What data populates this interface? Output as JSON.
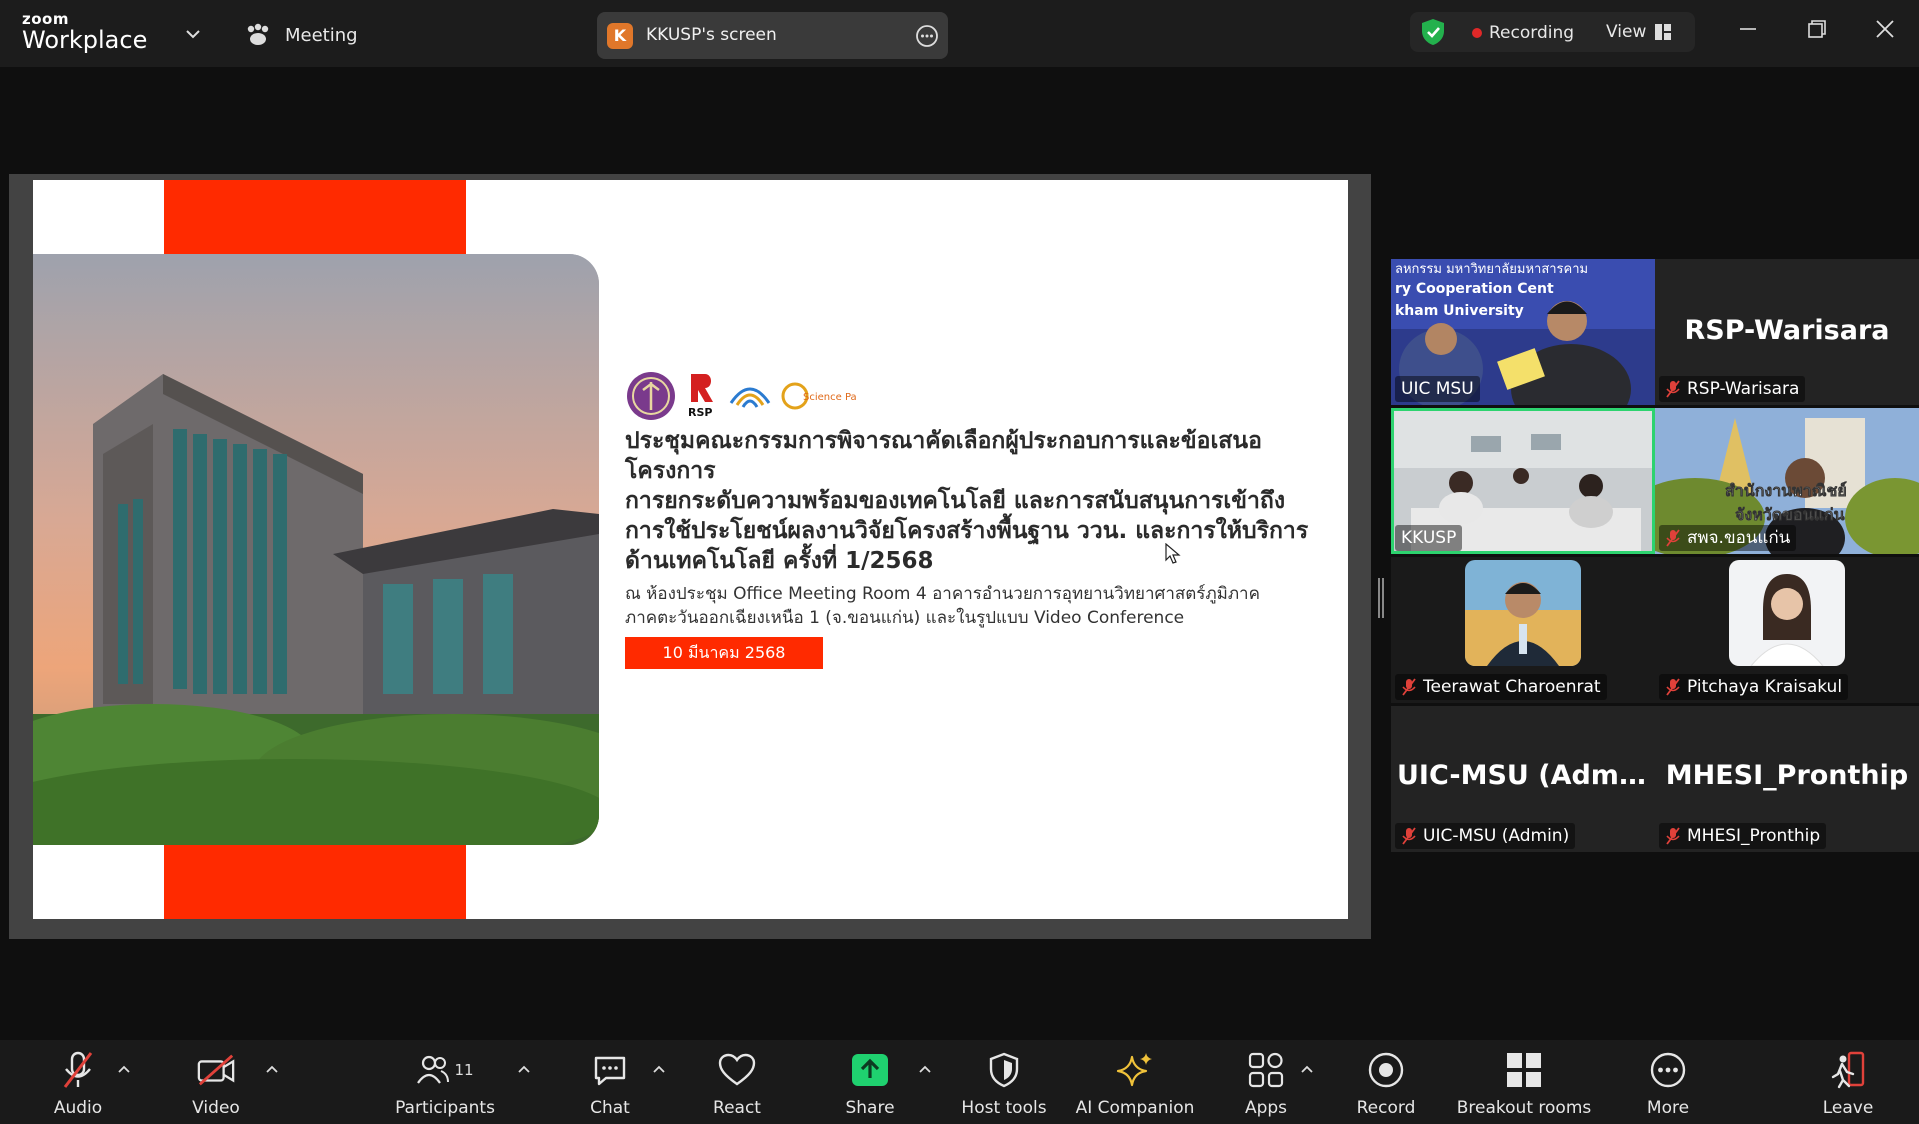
{
  "app": {
    "brand_small": "zoom",
    "brand_big": "Workplace"
  },
  "titlebar": {
    "meeting_label": "Meeting",
    "screen_share_label": "KKUSP's screen",
    "screen_share_initial": "K",
    "recording_label": "Recording",
    "view_label": "View"
  },
  "slide": {
    "heading_lines": [
      "ประชุมคณะกรรมการพิจารณาคัดเลือกผู้ประกอบการและข้อเสนอโครงการ",
      "การยกระดับความพร้อมของเทคโนโลยี และการสนับสนุนการเข้าถึง",
      "การใช้ประโยชน์ผลงานวิจัยโครงสร้างพื้นฐาน ววน. และการให้บริการ",
      "ด้านเทคโนโลยี ครั้งที่ 1/2568"
    ],
    "venue_lines": [
      "ณ ห้องประชุม Office Meeting Room 4 อาคารอำนวยการอุทยานวิทยาศาสตร์ภูมิภาค",
      "ภาคตะวันออกเฉียงเหนือ 1 (จ.ขอนแก่น) และในรูปแบบ Video Conference"
    ],
    "date": "10 มีนาคม 2568",
    "logo_texts": {
      "rsp": "RSP",
      "science_park": "Science Park"
    }
  },
  "participants": [
    {
      "name": "UIC MSU",
      "big_name": "",
      "muted": false,
      "kind": "video-room"
    },
    {
      "name": "RSP-Warisara",
      "big_name": "RSP-Warisara",
      "muted": true,
      "kind": "name-only"
    },
    {
      "name": "KKUSP",
      "big_name": "",
      "muted": false,
      "kind": "video-meeting",
      "active": true
    },
    {
      "name": "สพจ.ขอนแก่น",
      "big_name": "",
      "muted": true,
      "kind": "video-person"
    },
    {
      "name": "Teerawat Charoenrat",
      "big_name": "",
      "muted": true,
      "kind": "avatar"
    },
    {
      "name": "Pitchaya Kraisakul",
      "big_name": "",
      "muted": true,
      "kind": "avatar"
    },
    {
      "name": "UIC-MSU (Admin)",
      "big_name": "UIC-MSU  (Admi...",
      "muted": true,
      "kind": "name-only"
    },
    {
      "name": "MHESI_Pronthip",
      "big_name": "MHESI_Pronthip",
      "muted": true,
      "kind": "name-only"
    }
  ],
  "tile_overlay_texts": {
    "uic_banner_1": "ลหกรรม มหาวิทยาลัยมหาสารคาม",
    "uic_banner_2": "ry Cooperation Cent",
    "uic_banner_3": "kham University",
    "spj_overlay_1": "สำนักงานพาณิชย์",
    "spj_overlay_2": "จังหวัดขอนแก่น"
  },
  "toolbar": {
    "audio": "Audio",
    "video": "Video",
    "participants": "Participants",
    "participants_count": "11",
    "chat": "Chat",
    "react": "React",
    "share": "Share",
    "host_tools": "Host tools",
    "ai_companion": "AI Companion",
    "apps": "Apps",
    "record": "Record",
    "breakout_rooms": "Breakout rooms",
    "more": "More",
    "leave": "Leave"
  },
  "colors": {
    "accent_red": "#ff2a00",
    "share_green": "#1fd16f",
    "active_speaker": "#2dd36f",
    "muted_red": "#e0413a",
    "ai_gold": "#f0c23a"
  },
  "icons": {
    "shield": "shield-check-icon",
    "recording": "recording-dot-icon",
    "view": "view-grid-icon",
    "minimize": "minimize-icon",
    "restore": "restore-icon",
    "close": "close-icon"
  }
}
